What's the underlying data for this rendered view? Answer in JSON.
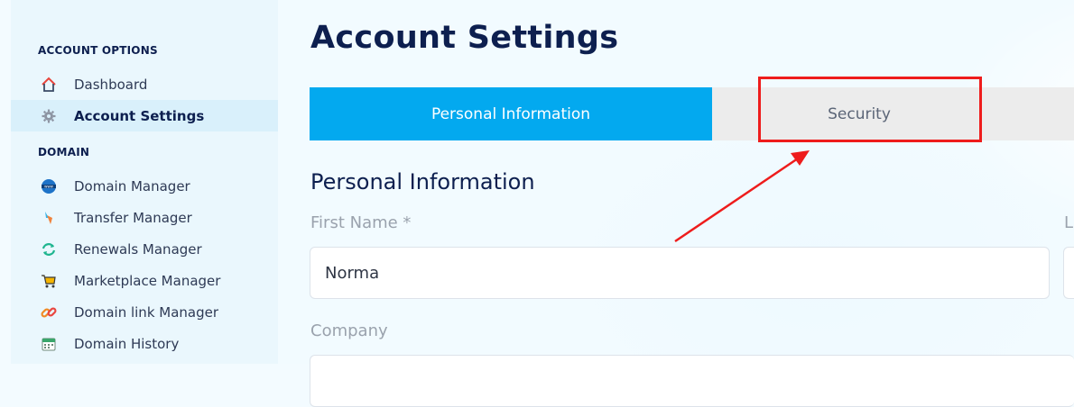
{
  "sidebar": {
    "sections": [
      {
        "heading": "ACCOUNT OPTIONS",
        "items": [
          {
            "label": "Dashboard",
            "icon": "home-icon"
          },
          {
            "label": "Account Settings",
            "icon": "gear-icon",
            "active": true
          }
        ]
      },
      {
        "heading": "DOMAIN",
        "items": [
          {
            "label": "Domain Manager",
            "icon": "www-globe-icon"
          },
          {
            "label": "Transfer Manager",
            "icon": "transfer-icon"
          },
          {
            "label": "Renewals Manager",
            "icon": "renew-icon"
          },
          {
            "label": "Marketplace Manager",
            "icon": "cart-icon"
          },
          {
            "label": "Domain link Manager",
            "icon": "link-icon"
          },
          {
            "label": "Domain History",
            "icon": "calendar-icon"
          }
        ]
      }
    ]
  },
  "main": {
    "title": "Account Settings",
    "tabs": [
      {
        "label": "Personal Information",
        "active": true
      },
      {
        "label": "Security",
        "highlighted": true
      }
    ],
    "section_title": "Personal Information",
    "fields": {
      "first_name": {
        "label": "First Name *",
        "value": "Norma"
      },
      "last_name": {
        "label": "L"
      },
      "company": {
        "label": "Company",
        "value": ""
      }
    }
  },
  "colors": {
    "accent": "#03a9ef",
    "annotation": "#ee1c1c",
    "heading": "#0d1f4f"
  }
}
